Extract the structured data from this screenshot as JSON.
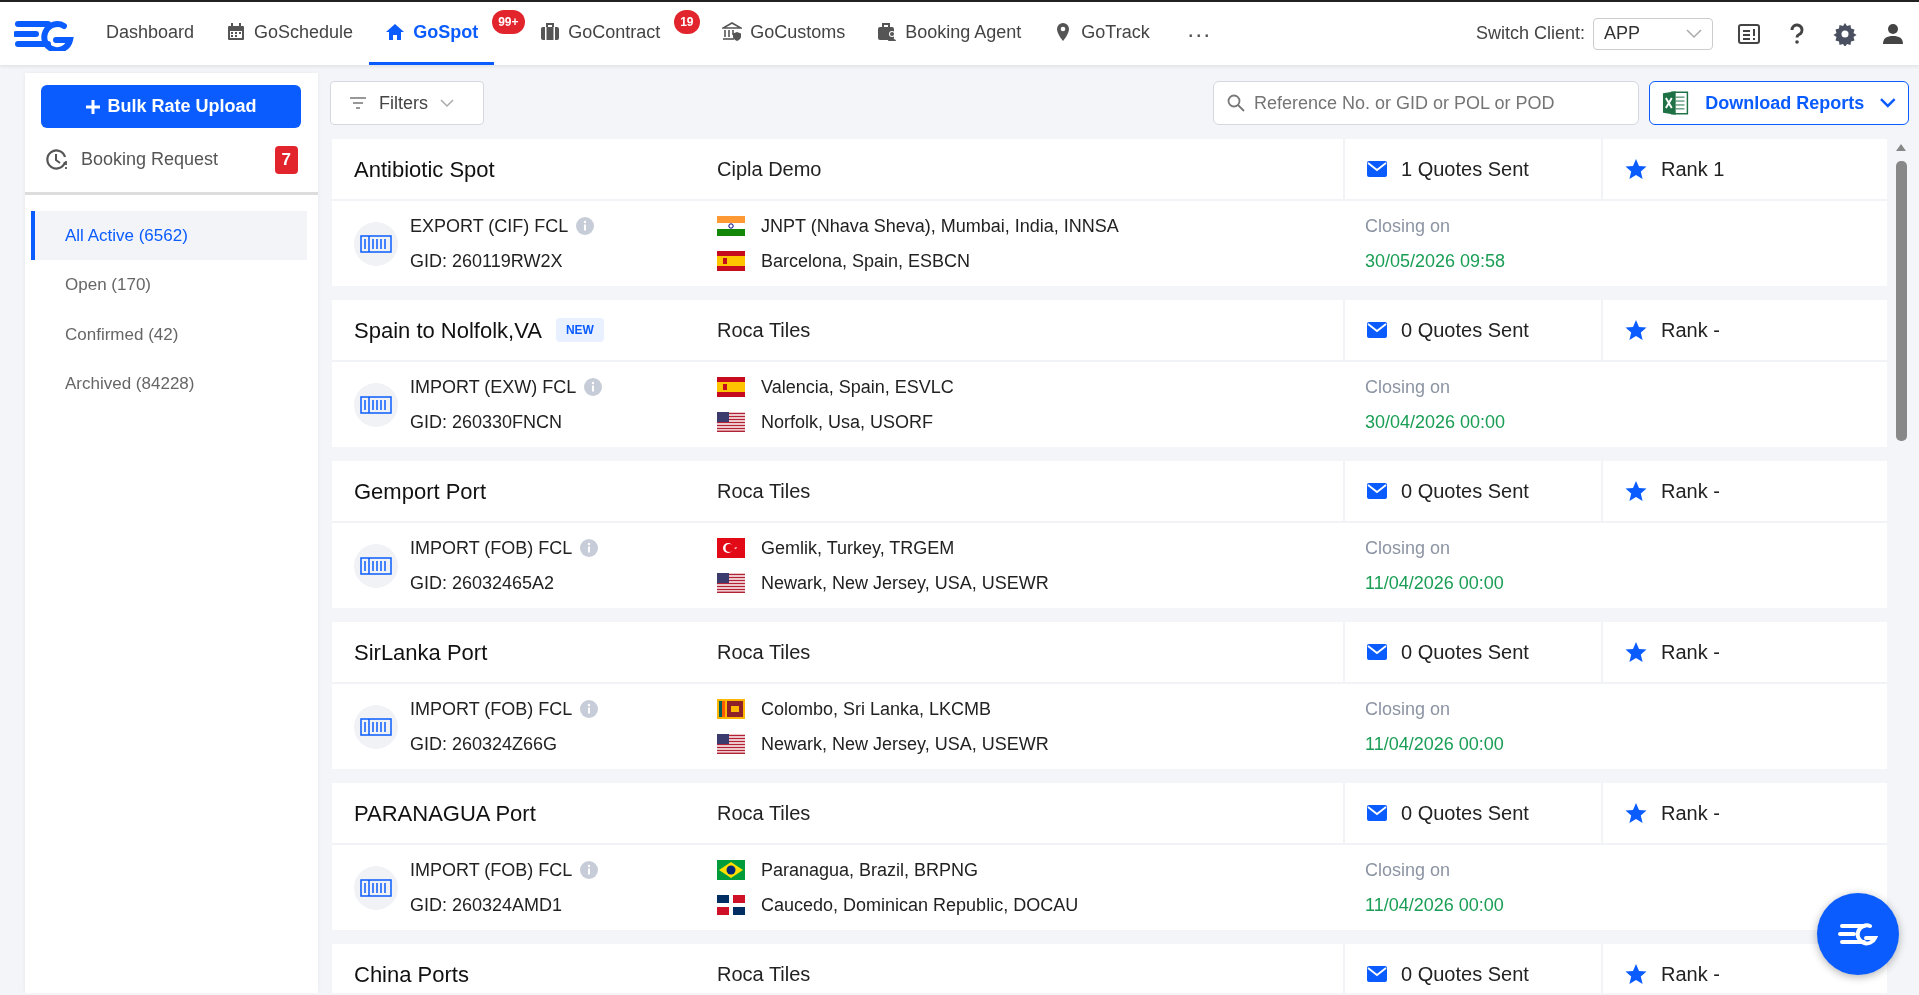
{
  "nav": {
    "items": [
      {
        "label": "Dashboard",
        "kind": "none",
        "selected": false
      },
      {
        "label": "GoSchedule",
        "kind": "calendar",
        "selected": false
      },
      {
        "label": "GoSpot",
        "kind": "house",
        "selected": true,
        "badge": "99+"
      },
      {
        "label": "GoContract",
        "kind": "briefcase",
        "selected": false,
        "badge": "19"
      },
      {
        "label": "GoCustoms",
        "kind": "bank",
        "selected": false
      },
      {
        "label": "Booking Agent",
        "kind": "agent",
        "selected": false
      },
      {
        "label": "GoTrack",
        "kind": "pin",
        "selected": false
      }
    ],
    "more": "···",
    "switch_label": "Switch Client:",
    "client": "APP"
  },
  "sidebar": {
    "upload_button": "Bulk Rate Upload",
    "booking_request": "Booking Request",
    "booking_count": "7",
    "filters": [
      {
        "label": "All Active (6562)",
        "selected": true
      },
      {
        "label": "Open (170)",
        "selected": false
      },
      {
        "label": "Confirmed (42)",
        "selected": false
      },
      {
        "label": "Archived (84228)",
        "selected": false
      }
    ]
  },
  "toolbar": {
    "filters": "Filters",
    "search_placeholder": "Reference No. or GID or POL or POD",
    "download": "Download Reports"
  },
  "spots": [
    {
      "title": "Antibiotic Spot",
      "client": "Cipla Demo",
      "quotes": "1 Quotes Sent",
      "rank": "Rank 1",
      "type": "EXPORT (CIF) FCL",
      "gid": "GID: 260119RW2X",
      "from": {
        "kind": "india",
        "name": "JNPT (Nhava Sheva), Mumbai, India, INNSA"
      },
      "to": {
        "kind": "spain",
        "name": "Barcelona, Spain, ESBCN"
      },
      "closing_label": "Closing on",
      "closing": "30/05/2026 09:58"
    },
    {
      "title": "Spain to Nolfolk,VA",
      "badge": "NEW",
      "client": "Roca Tiles",
      "quotes": "0 Quotes Sent",
      "rank": "Rank -",
      "type": "IMPORT (EXW) FCL",
      "gid": "GID: 260330FNCN",
      "from": {
        "kind": "spain",
        "name": "Valencia, Spain, ESVLC"
      },
      "to": {
        "kind": "usa",
        "name": "Norfolk, Usa, USORF"
      },
      "closing_label": "Closing on",
      "closing": "30/04/2026 00:00"
    },
    {
      "title": "Gemport Port",
      "client": "Roca Tiles",
      "quotes": "0 Quotes Sent",
      "rank": "Rank -",
      "type": "IMPORT (FOB) FCL",
      "gid": "GID: 26032465A2",
      "from": {
        "kind": "turkey",
        "name": "Gemlik, Turkey, TRGEM"
      },
      "to": {
        "kind": "usa",
        "name": "Newark, New Jersey, USA, USEWR"
      },
      "closing_label": "Closing on",
      "closing": "11/04/2026 00:00"
    },
    {
      "title": "SirLanka Port",
      "client": "Roca Tiles",
      "quotes": "0 Quotes Sent",
      "rank": "Rank -",
      "type": "IMPORT (FOB) FCL",
      "gid": "GID: 260324Z66G",
      "from": {
        "kind": "srilanka",
        "name": "Colombo, Sri Lanka, LKCMB"
      },
      "to": {
        "kind": "usa",
        "name": "Newark, New Jersey, USA, USEWR"
      },
      "closing_label": "Closing on",
      "closing": "11/04/2026 00:00"
    },
    {
      "title": "PARANAGUA Port",
      "client": "Roca Tiles",
      "quotes": "0 Quotes Sent",
      "rank": "Rank -",
      "type": "IMPORT (FOB) FCL",
      "gid": "GID: 260324AMD1",
      "from": {
        "kind": "brazil",
        "name": "Paranagua, Brazil, BRPNG"
      },
      "to": {
        "kind": "dominican",
        "name": "Caucedo, Dominican Republic, DOCAU"
      },
      "closing_label": "Closing on",
      "closing": "11/04/2026 00:00"
    },
    {
      "title": "China Ports",
      "client": "Roca Tiles",
      "quotes": "0 Quotes Sent",
      "rank": "Rank -"
    }
  ]
}
